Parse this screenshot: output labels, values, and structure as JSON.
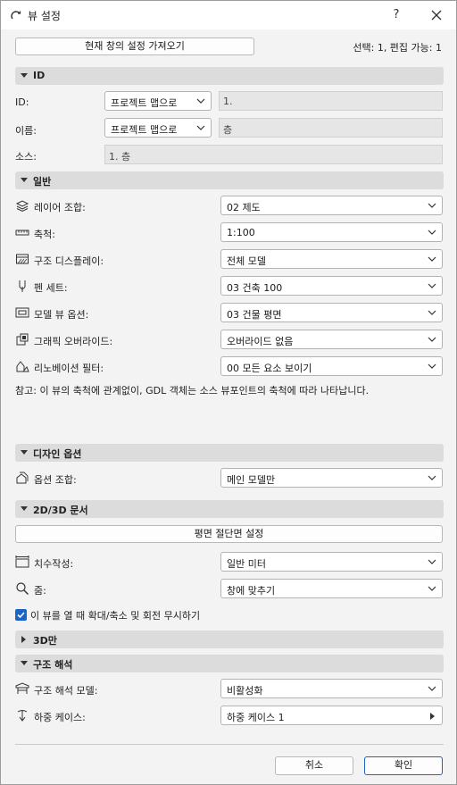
{
  "window": {
    "title": "뷰 설정",
    "help_label": "?",
    "icons": {
      "title": "view-settings-icon",
      "close": "close-icon"
    }
  },
  "top": {
    "import_button": "현재 창의 설정 가져오기",
    "selection_info": "선택: 1, 편집 가능: 1"
  },
  "sections": {
    "id": "ID",
    "general": "일반",
    "design_options": "디자인 옵션",
    "doc2d3d": "2D/3D 문서",
    "only3d": "3D만",
    "structural": "구조 해석"
  },
  "id_section": {
    "id_label": "ID:",
    "id_dropdown": "프로젝트 맵으로",
    "id_value": "1.",
    "name_label": "이름:",
    "name_dropdown": "프로젝트 맵으로",
    "name_value": "층",
    "source_label": "소스:",
    "source_value": "1. 층"
  },
  "general": {
    "rows": [
      {
        "label": "레이어 조합:",
        "value": "02 제도",
        "icon": "layers-icon"
      },
      {
        "label": "축척:",
        "value": "1:100",
        "icon": "scale-ruler-icon"
      },
      {
        "label": "구조 디스플레이:",
        "value": "전체 모델",
        "icon": "structure-display-icon"
      },
      {
        "label": "펜 세트:",
        "value": "03 건축 100",
        "icon": "pen-icon"
      },
      {
        "label": "모델 뷰 옵션:",
        "value": "03 건물 평면",
        "icon": "model-view-icon"
      },
      {
        "label": "그래픽 오버라이드:",
        "value": "오버라이드 없음",
        "icon": "graphic-override-icon"
      },
      {
        "label": "리노베이션 필터:",
        "value": "00 모든 요소 보이기",
        "icon": "renovation-filter-icon"
      }
    ],
    "note": "참고: 이 뷰의 축척에 관계없이, GDL 객체는 소스 뷰포인트의 축척에 따라 나타납니다."
  },
  "design_options": {
    "label": "옵션 조합:",
    "value": "메인 모델만",
    "icon": "design-options-icon"
  },
  "doc2d3d": {
    "section_cut_button": "평면 절단면 설정",
    "dimension_label": "치수작성:",
    "dimension_value": "일반 미터",
    "dimension_icon": "dimension-icon",
    "zoom_label": "줌:",
    "zoom_value": "창에 맞추기",
    "zoom_icon": "zoom-icon",
    "ignore_zoom_checkbox": "이 뷰를 열 때 확대/축소 및 회전 무시하기",
    "ignore_zoom_checked": true
  },
  "structural": {
    "model_label": "구조 해석 모델:",
    "model_value": "비활성화",
    "model_icon": "structural-model-icon",
    "load_label": "하중 케이스:",
    "load_value": "하중 케이스 1",
    "load_icon": "load-case-icon"
  },
  "footer": {
    "cancel": "취소",
    "ok": "확인"
  },
  "colors": {
    "accent": "#1b64c8",
    "section_bg": "#dcdcdc",
    "window_bg": "#f3f3f3"
  }
}
